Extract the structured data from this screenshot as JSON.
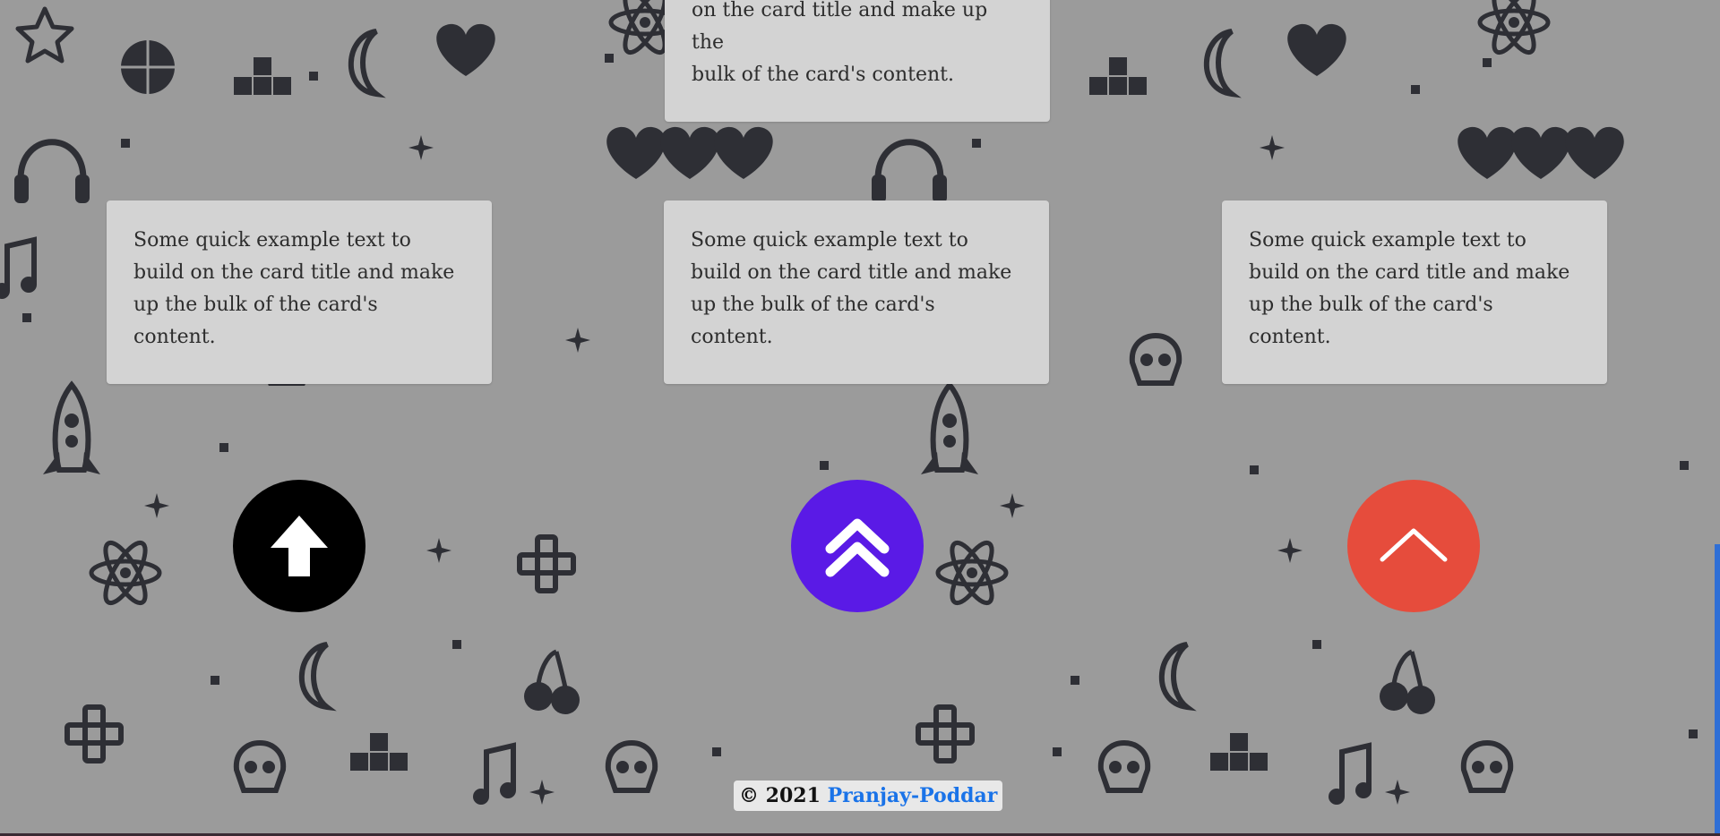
{
  "cards": {
    "top_partial": {
      "line1": "on the card title and make up the",
      "line2": "bulk of the card's content."
    },
    "left": {
      "text": "Some quick example text to build on the card title and make up the bulk of the card's content."
    },
    "center": {
      "text": "Some quick example text to build on the card title and make up the bulk of the card's content."
    },
    "right": {
      "text": "Some quick example text to build on the card title and make up the bulk of the card's content."
    }
  },
  "buttons": {
    "black": {
      "icon": "arrow-up-icon",
      "color": "#000000"
    },
    "purple": {
      "icon": "double-chevron-up-icon",
      "color": "#5a1ae6"
    },
    "red": {
      "icon": "chevron-up-icon",
      "color": "#e64c3c"
    }
  },
  "footer": {
    "copyright": "© 2021",
    "author_link": "Pranjay-Poddar"
  },
  "colors": {
    "background": "#9b9b9b",
    "pattern_icons": "#2e2f35",
    "card_background": "#d3d3d3",
    "link": "#1a73e8"
  }
}
